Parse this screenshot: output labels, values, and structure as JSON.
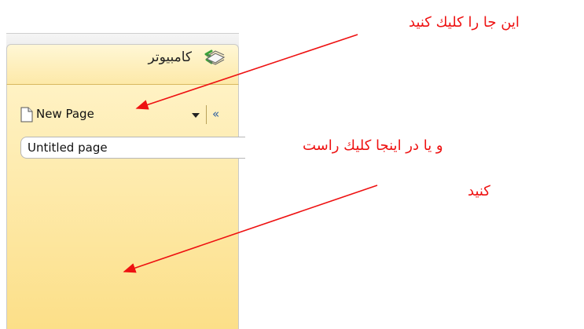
{
  "panel": {
    "notebook_title": "كامبيوتر",
    "new_page_label": "New Page",
    "collapse_label": "«",
    "pages": [
      {
        "title": "Untitled page"
      }
    ]
  },
  "annotations": {
    "click_here": "اين جا را كليك كنيد",
    "right_click_line1": "و يا در اينجا كليك راست",
    "right_click_line2": "كنيد"
  },
  "colors": {
    "annotation": "#ee1111",
    "panel_top": "#fff2c4",
    "panel_bottom": "#fcdf88",
    "collapse": "#2f5fa0"
  },
  "icons": {
    "back": "green-back-arrow-icon",
    "notebook": "notebook-stack-icon",
    "page": "blank-page-icon",
    "dropdown": "dropdown-arrow-icon"
  }
}
